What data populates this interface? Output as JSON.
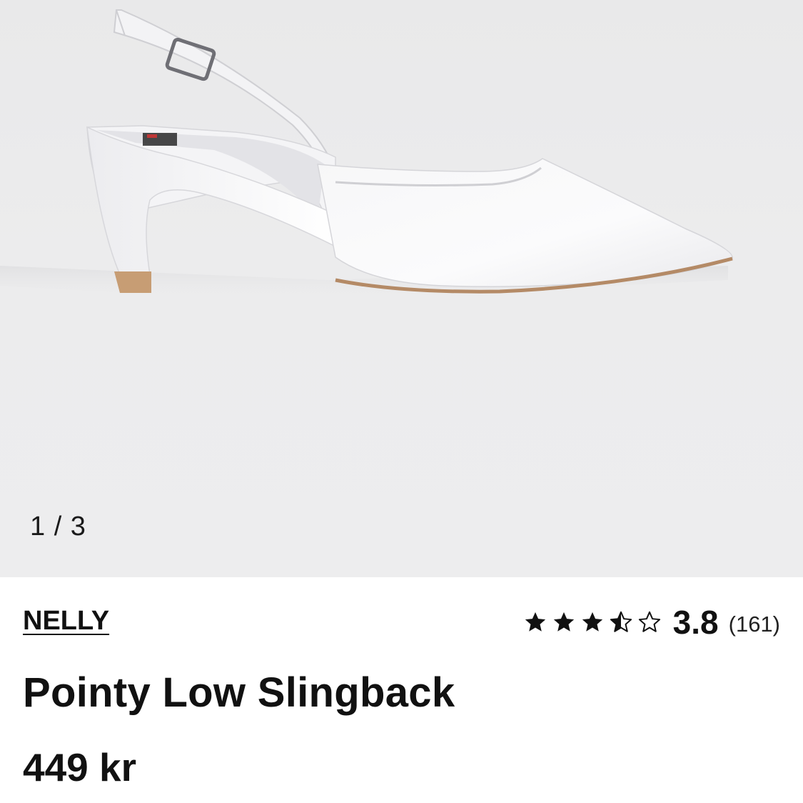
{
  "gallery": {
    "counter": "1 / 3",
    "current_index": 1,
    "total_images": 3,
    "image_subject": "white pointed-toe slingback kitten-heel shoe",
    "background_color": "#ebebec"
  },
  "product": {
    "brand": "NELLY",
    "title": "Pointy Low Slingback",
    "price": "449 kr"
  },
  "rating": {
    "value": "3.8",
    "count": "(161)",
    "stars": [
      "star-filled",
      "star-filled",
      "star-filled",
      "star-half",
      "star-empty"
    ]
  }
}
